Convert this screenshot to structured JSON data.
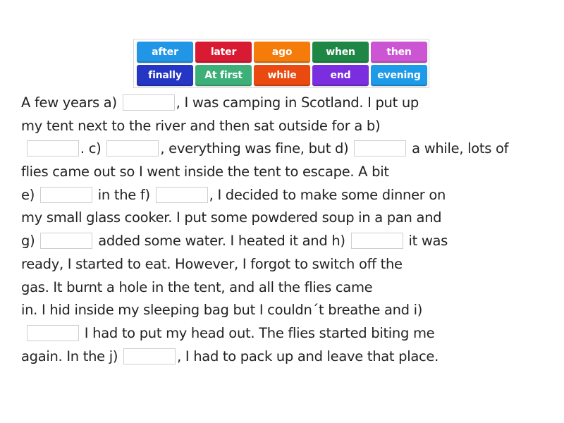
{
  "word_bank": {
    "tiles": [
      {
        "label": "after",
        "color": "#2196e6"
      },
      {
        "label": "later",
        "color": "#d81b33"
      },
      {
        "label": "ago",
        "color": "#f57c0a"
      },
      {
        "label": "when",
        "color": "#1e8746"
      },
      {
        "label": "then",
        "color": "#cc55d4"
      },
      {
        "label": "finally",
        "color": "#2535c4"
      },
      {
        "label": "At first",
        "color": "#3db07a"
      },
      {
        "label": "while",
        "color": "#ea4a10"
      },
      {
        "label": "end",
        "color": "#7a2ee0"
      },
      {
        "label": "evening",
        "color": "#1e9be8"
      }
    ]
  },
  "passage": {
    "lines": [
      [
        "A few years a) ",
        "__a",
        ", I was camping in Scotland. I put up"
      ],
      [
        "my tent next to the river and then sat outside for a b)"
      ],
      [
        " ",
        "__b",
        ". c) ",
        "__c",
        ", everything was fine, but d) ",
        "__d",
        " a while, lots of"
      ],
      [
        "flies came out so I went inside the tent to escape. A bit"
      ],
      [
        "e) ",
        "__e",
        " in the f) ",
        "__f",
        ", I decided to make some dinner on"
      ],
      [
        "my small glass cooker. I put some powdered soup in a pan and"
      ],
      [
        "g) ",
        "__g",
        " added some water. I heated it and h) ",
        "__h",
        " it was"
      ],
      [
        "ready, I started to eat. However, I forgot to switch off the"
      ],
      [
        "gas. It burnt a hole in the tent, and all the flies came"
      ],
      [
        "in. I hid inside my sleeping bag but I couldn´t breathe and i)"
      ],
      [
        " ",
        "__i",
        " I had to put my head out. The flies started biting me"
      ],
      [
        "again. In the j) ",
        "__j",
        ", I had to pack up and leave that place."
      ]
    ],
    "blanks": {
      "a": "",
      "b": "",
      "c": "",
      "d": "",
      "e": "",
      "f": "",
      "g": "",
      "h": "",
      "i": "",
      "j": ""
    }
  }
}
